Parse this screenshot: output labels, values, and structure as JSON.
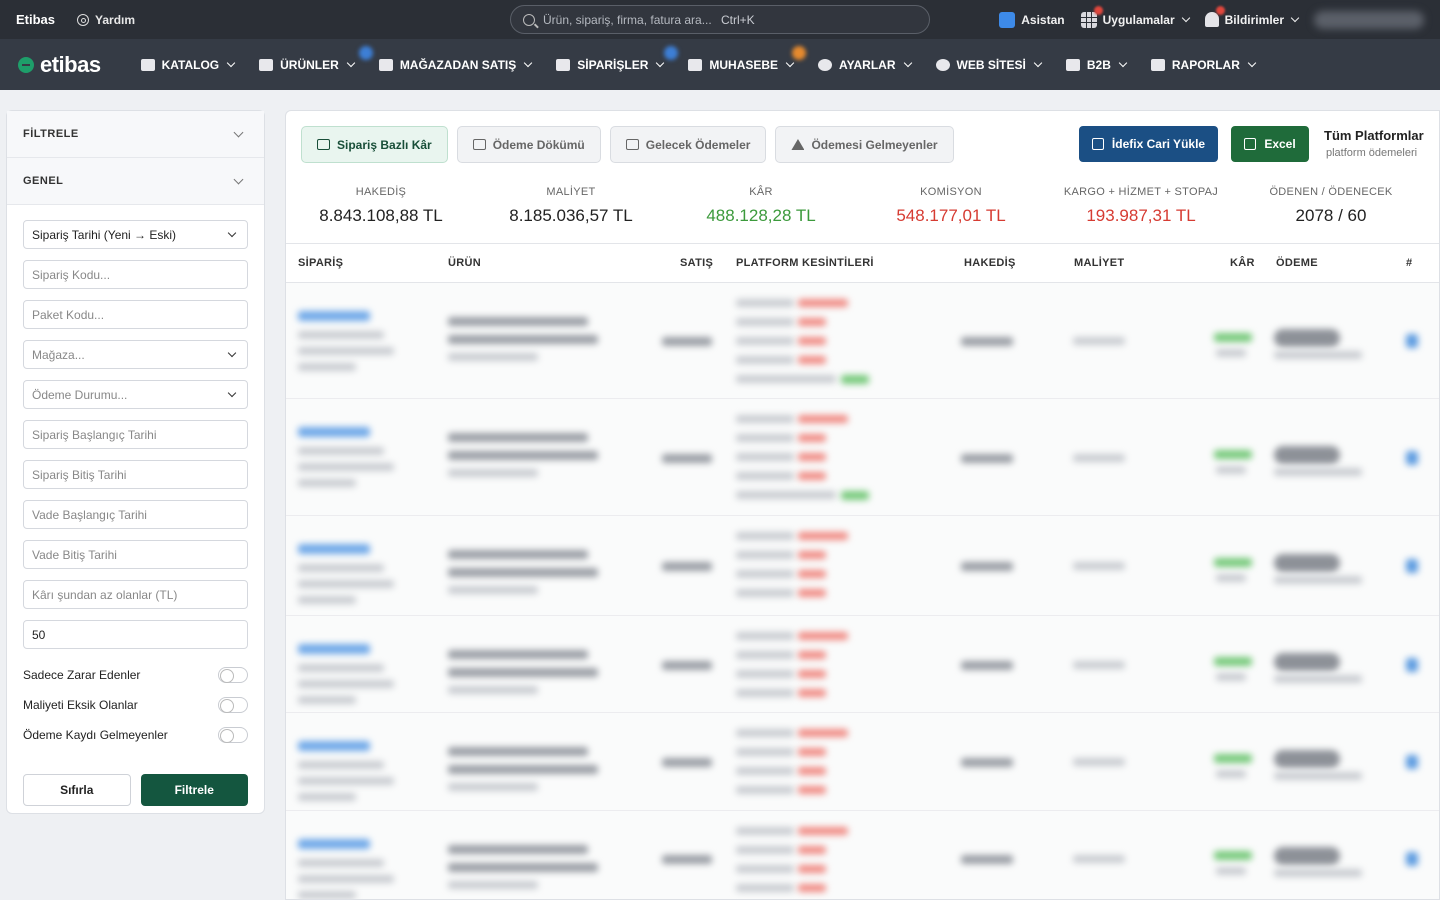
{
  "topbar": {
    "brand": "Etibas",
    "help": "Yardım",
    "search_placeholder": "Ürün, sipariş, firma, fatura ara...",
    "search_shortcut": "Ctrl+K",
    "assistant": "Asistan",
    "apps": "Uygulamalar",
    "notifications": "Bildirimler"
  },
  "nav": {
    "logo": "etibas",
    "items": [
      "KATALOG",
      "ÜRÜNLER",
      "MAĞAZADAN SATIŞ",
      "SİPARİŞLER",
      "MUHASEBE",
      "AYARLAR",
      "WEB SİTESİ",
      "B2B",
      "RAPORLAR"
    ]
  },
  "filters": {
    "header": "FİLTRELE",
    "section": "GENEL",
    "sort_value": "Sipariş Tarihi (Yeni → Eski)",
    "order_code_ph": "Sipariş Kodu...",
    "package_code_ph": "Paket Kodu...",
    "store_ph": "Mağaza...",
    "payment_status_ph": "Ödeme Durumu...",
    "order_start_ph": "Sipariş Başlangıç Tarihi",
    "order_end_ph": "Sipariş Bitiş Tarihi",
    "due_start_ph": "Vade Başlangıç Tarihi",
    "due_end_ph": "Vade Bitiş Tarihi",
    "profit_less_ph": "Kârı şundan az olanlar (TL)",
    "limit_value": "50",
    "toggle_loss": "Sadece Zarar Edenler",
    "toggle_missing_cost": "Maliyeti Eksik Olanlar",
    "toggle_no_payment": "Ödeme Kaydı Gelmeyenler",
    "reset": "Sıfırla",
    "apply": "Filtrele"
  },
  "tabs": [
    "Sipariş Bazlı Kâr",
    "Ödeme Dökümü",
    "Gelecek Ödemeler",
    "Ödemesi Gelmeyenler"
  ],
  "actions": {
    "idefix": "İdefix Cari Yükle",
    "excel": "Excel",
    "platform_title": "Tüm Platformlar",
    "platform_sub": "platform ödemeleri"
  },
  "stats": [
    {
      "label": "HAKEDİŞ",
      "value": "8.843.108,88 TL",
      "tone": "neutral"
    },
    {
      "label": "MALİYET",
      "value": "8.185.036,57 TL",
      "tone": "neutral"
    },
    {
      "label": "KÂR",
      "value": "488.128,28 TL",
      "tone": "green"
    },
    {
      "label": "KOMİSYON",
      "value": "548.177,01 TL",
      "tone": "red"
    },
    {
      "label": "KARGO + HİZMET + STOPAJ",
      "value": "193.987,31 TL",
      "tone": "red"
    },
    {
      "label": "ÖDENEN / ÖDENECEK",
      "value": "2078 / 60",
      "tone": "neutral"
    }
  ],
  "table": {
    "headers": [
      "SİPARİŞ",
      "ÜRÜN",
      "SATIŞ",
      "PLATFORM KESİNTİLERİ",
      "HAKEDİŞ",
      "MALİYET",
      "KÂR",
      "ÖDEME",
      "#"
    ]
  },
  "colors": {
    "topbar": "#2b2f36",
    "navbar": "#353b45",
    "primary_green": "#14563f",
    "idefix_blue": "#1b4f84",
    "excel_green": "#1f6b3a",
    "profit_green": "#3c9a3c",
    "loss_red": "#d63b32"
  }
}
